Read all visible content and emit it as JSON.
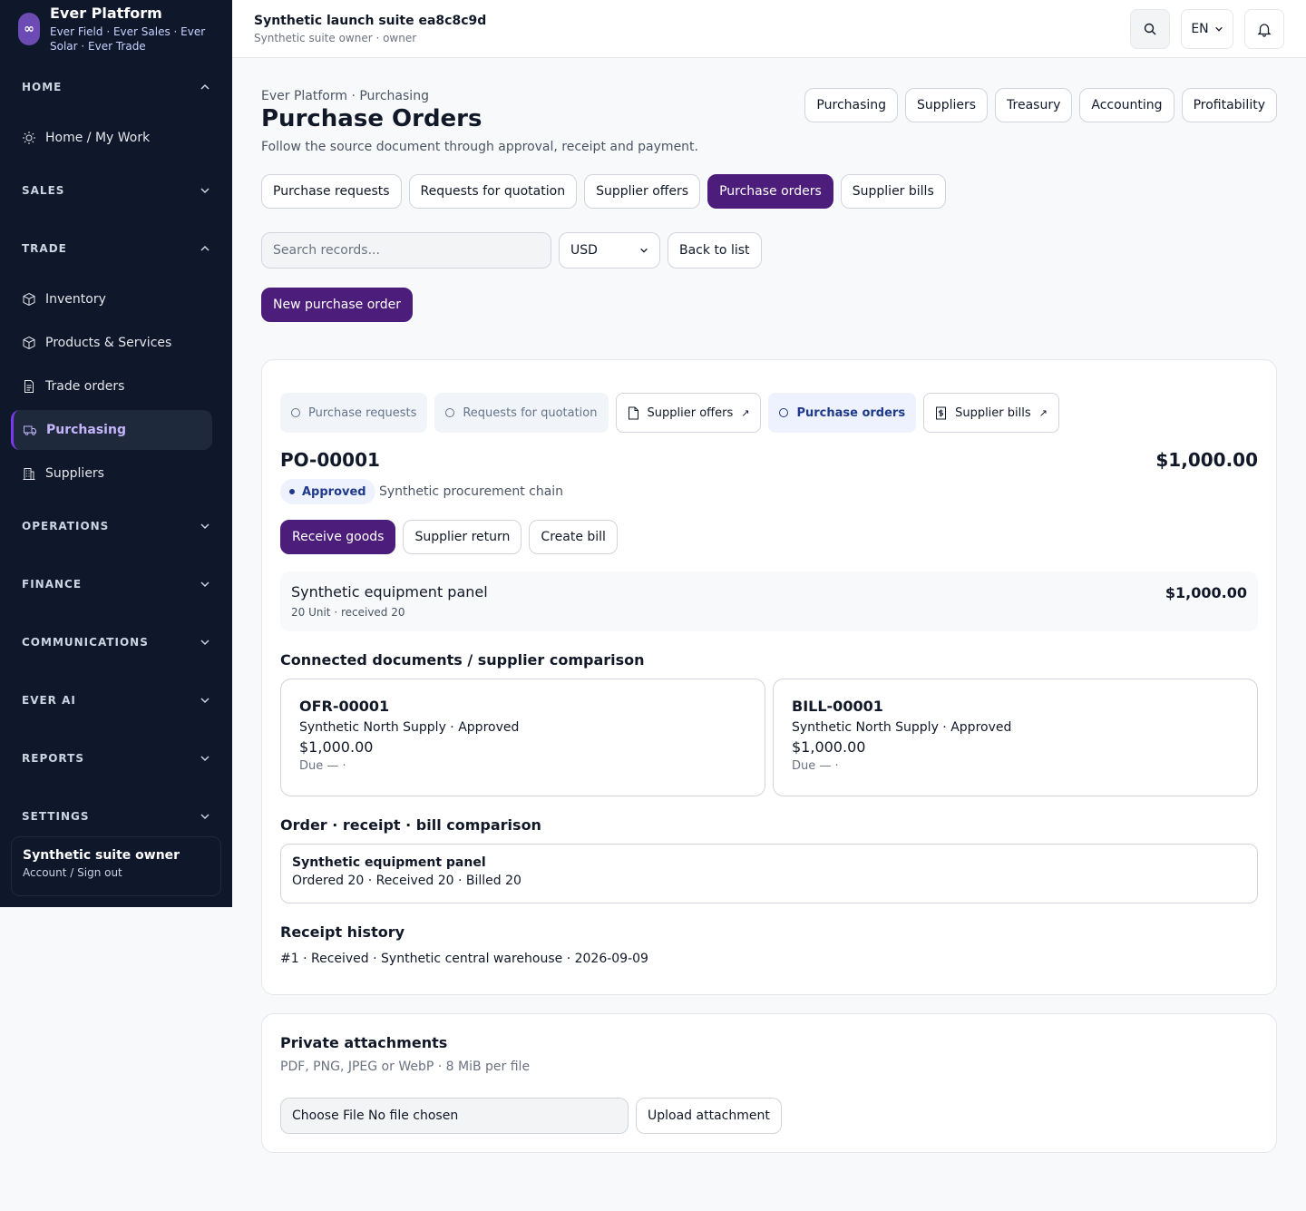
{
  "brand": {
    "title": "Ever Platform",
    "subtitle": "Ever Field · Ever Sales · Ever Solar · Ever Trade",
    "logo_glyph": "∞"
  },
  "sidebar": {
    "sections": [
      {
        "label": "HOME",
        "expanded": true
      },
      {
        "label": "SALES",
        "expanded": false
      },
      {
        "label": "TRADE",
        "expanded": true
      },
      {
        "label": "OPERATIONS",
        "expanded": false
      },
      {
        "label": "FINANCE",
        "expanded": false
      },
      {
        "label": "COMMUNICATIONS",
        "expanded": false
      },
      {
        "label": "EVER AI",
        "expanded": false
      },
      {
        "label": "REPORTS",
        "expanded": false
      },
      {
        "label": "SETTINGS",
        "expanded": false
      }
    ],
    "home_items": [
      {
        "label": "Home / My Work",
        "icon": "sun-icon"
      }
    ],
    "trade_items": [
      {
        "label": "Inventory",
        "icon": "box-icon"
      },
      {
        "label": "Products & Services",
        "icon": "box-icon"
      },
      {
        "label": "Trade orders",
        "icon": "document-icon"
      },
      {
        "label": "Purchasing",
        "icon": "truck-icon",
        "active": true
      },
      {
        "label": "Suppliers",
        "icon": "building-icon"
      }
    ],
    "account": {
      "name": "Synthetic suite owner",
      "action": "Account / Sign out"
    }
  },
  "topbar": {
    "title": "Synthetic launch suite ea8c8c9d",
    "subtitle": "Synthetic suite owner · owner",
    "language": "EN"
  },
  "page": {
    "breadcrumb": "Ever Platform · Purchasing",
    "title": "Purchase Orders",
    "description": "Follow the source document through approval, receipt and payment.",
    "module_nav": [
      "Purchasing",
      "Suppliers",
      "Treasury",
      "Accounting",
      "Profitability"
    ],
    "doc_tabs": [
      "Purchase requests",
      "Requests for quotation",
      "Supplier offers",
      "Purchase orders",
      "Supplier bills"
    ],
    "active_doc_tab": "Purchase orders",
    "search_placeholder": "Search records...",
    "currency": "USD",
    "back_label": "Back to list",
    "new_label": "New purchase order"
  },
  "order": {
    "stages": [
      {
        "label": "Purchase requests",
        "state": "muted"
      },
      {
        "label": "Requests for quotation",
        "state": "muted"
      },
      {
        "label": "Supplier offers",
        "state": "link"
      },
      {
        "label": "Purchase orders",
        "state": "current"
      },
      {
        "label": "Supplier bills",
        "state": "link"
      }
    ],
    "id": "PO-00001",
    "total": "$1,000.00",
    "status": "Approved",
    "chain": "Synthetic procurement chain",
    "actions": [
      "Receive goods",
      "Supplier return",
      "Create bill"
    ],
    "line": {
      "name": "Synthetic equipment panel",
      "meta": "20 Unit · received 20",
      "amount": "$1,000.00"
    },
    "connected_title": "Connected documents / supplier comparison",
    "connected": [
      {
        "id": "OFR-00001",
        "supplier": "Synthetic North Supply · Approved",
        "amount": "$1,000.00",
        "due": "Due — ·"
      },
      {
        "id": "BILL-00001",
        "supplier": "Synthetic North Supply · Approved",
        "amount": "$1,000.00",
        "due": "Due — ·"
      }
    ],
    "comparison_title": "Order · receipt · bill comparison",
    "comparison": {
      "name": "Synthetic equipment panel",
      "values": "Ordered 20 · Received 20 · Billed 20"
    },
    "receipt_title": "Receipt history",
    "receipt": "#1 · Received · Synthetic central warehouse · 2026-09-09"
  },
  "attachments": {
    "title": "Private attachments",
    "subtitle": "PDF, PNG, JPEG or WebP · 8 MiB per file",
    "file_label": "Choose File No file chosen",
    "upload_label": "Upload attachment"
  },
  "colors": {
    "sidebar_bg": "#0f172a",
    "primary": "#4c1d7a",
    "accent": "#7c3aed",
    "status": "#1e3a8a"
  }
}
